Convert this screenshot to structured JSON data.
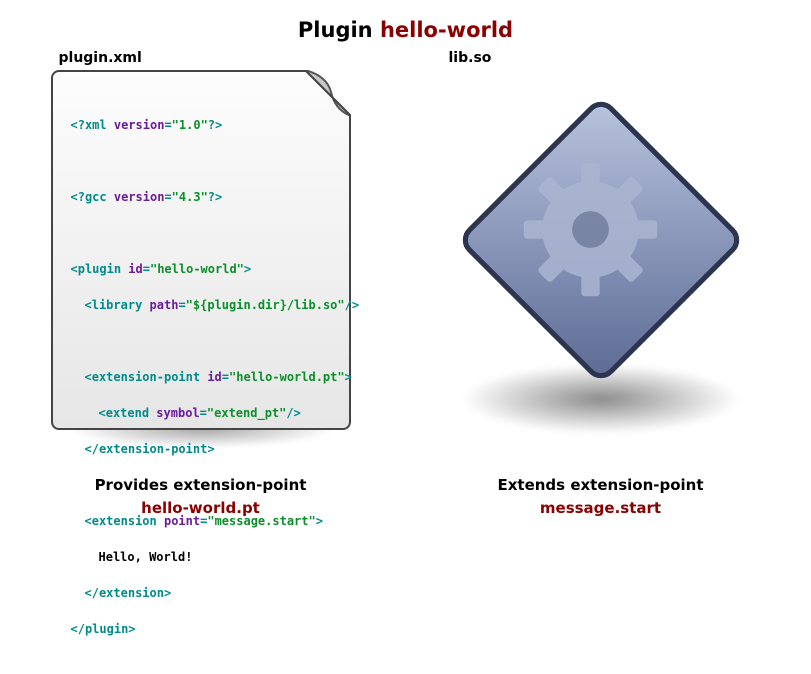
{
  "title": {
    "prefix": "Plugin ",
    "name": "hello-world"
  },
  "left": {
    "file_label": "plugin.xml",
    "caption_line1": "Provides extension-point",
    "caption_line2": "hello-world.pt",
    "xml": {
      "l1_a": "<?xml ",
      "l1_b": "version",
      "l1_c": "=",
      "l1_d": "\"1.0\"",
      "l1_e": "?>",
      "l2_a": "<?gcc ",
      "l2_b": "version",
      "l2_c": "=",
      "l2_d": "\"4.3\"",
      "l2_e": "?>",
      "l3_a": "<plugin ",
      "l3_b": "id",
      "l3_c": "=",
      "l3_d": "\"hello-world\"",
      "l3_e": ">",
      "l4_a": "<library ",
      "l4_b": "path",
      "l4_c": "=",
      "l4_d": "\"${plugin.dir}/lib.so\"",
      "l4_e": "/>",
      "l5_a": "<extension-point ",
      "l5_b": "id",
      "l5_c": "=",
      "l5_d": "\"hello-world.pt\"",
      "l5_e": ">",
      "l6_a": "<extend ",
      "l6_b": "symbol",
      "l6_c": "=",
      "l6_d": "\"extend_pt\"",
      "l6_e": "/>",
      "l7": "</extension-point>",
      "l8_a": "<extension ",
      "l8_b": "point",
      "l8_c": "=",
      "l8_d": "\"message.start\"",
      "l8_e": ">",
      "l9": "Hello, World!",
      "l10": "</extension>",
      "l11": "</plugin>"
    }
  },
  "right": {
    "file_label": "lib.so",
    "caption_line1": "Extends extension-point",
    "caption_line2": "message.start"
  }
}
